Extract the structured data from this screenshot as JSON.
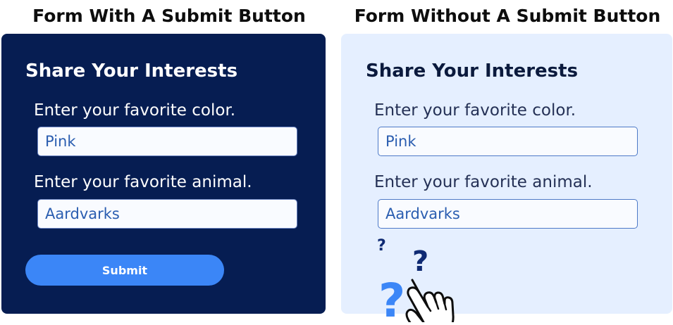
{
  "left": {
    "heading": "Form With A Submit Button",
    "form_title": "Share Your Interests",
    "q1_label": "Enter your favorite color.",
    "q1_value": "Pink",
    "q2_label": "Enter your favorite animal.",
    "q2_value": "Aardvarks",
    "submit_label": "Submit"
  },
  "right": {
    "heading": "Form Without A Submit Button",
    "form_title": "Share Your Interests",
    "q1_label": "Enter your favorite color.",
    "q1_value": "Pink",
    "q2_label": "Enter your favorite animal.",
    "q2_value": "Aardvarks",
    "question_marks": [
      "?",
      "?",
      "?"
    ],
    "icons": [
      "question-mark-icon",
      "pointing-hand-icon"
    ]
  },
  "colors": {
    "left_panel_bg": "#061d52",
    "right_panel_bg": "#e5efff",
    "submit_bg": "#3b86f7",
    "question_dark": "#0f2a73",
    "question_light": "#3b86f7"
  }
}
